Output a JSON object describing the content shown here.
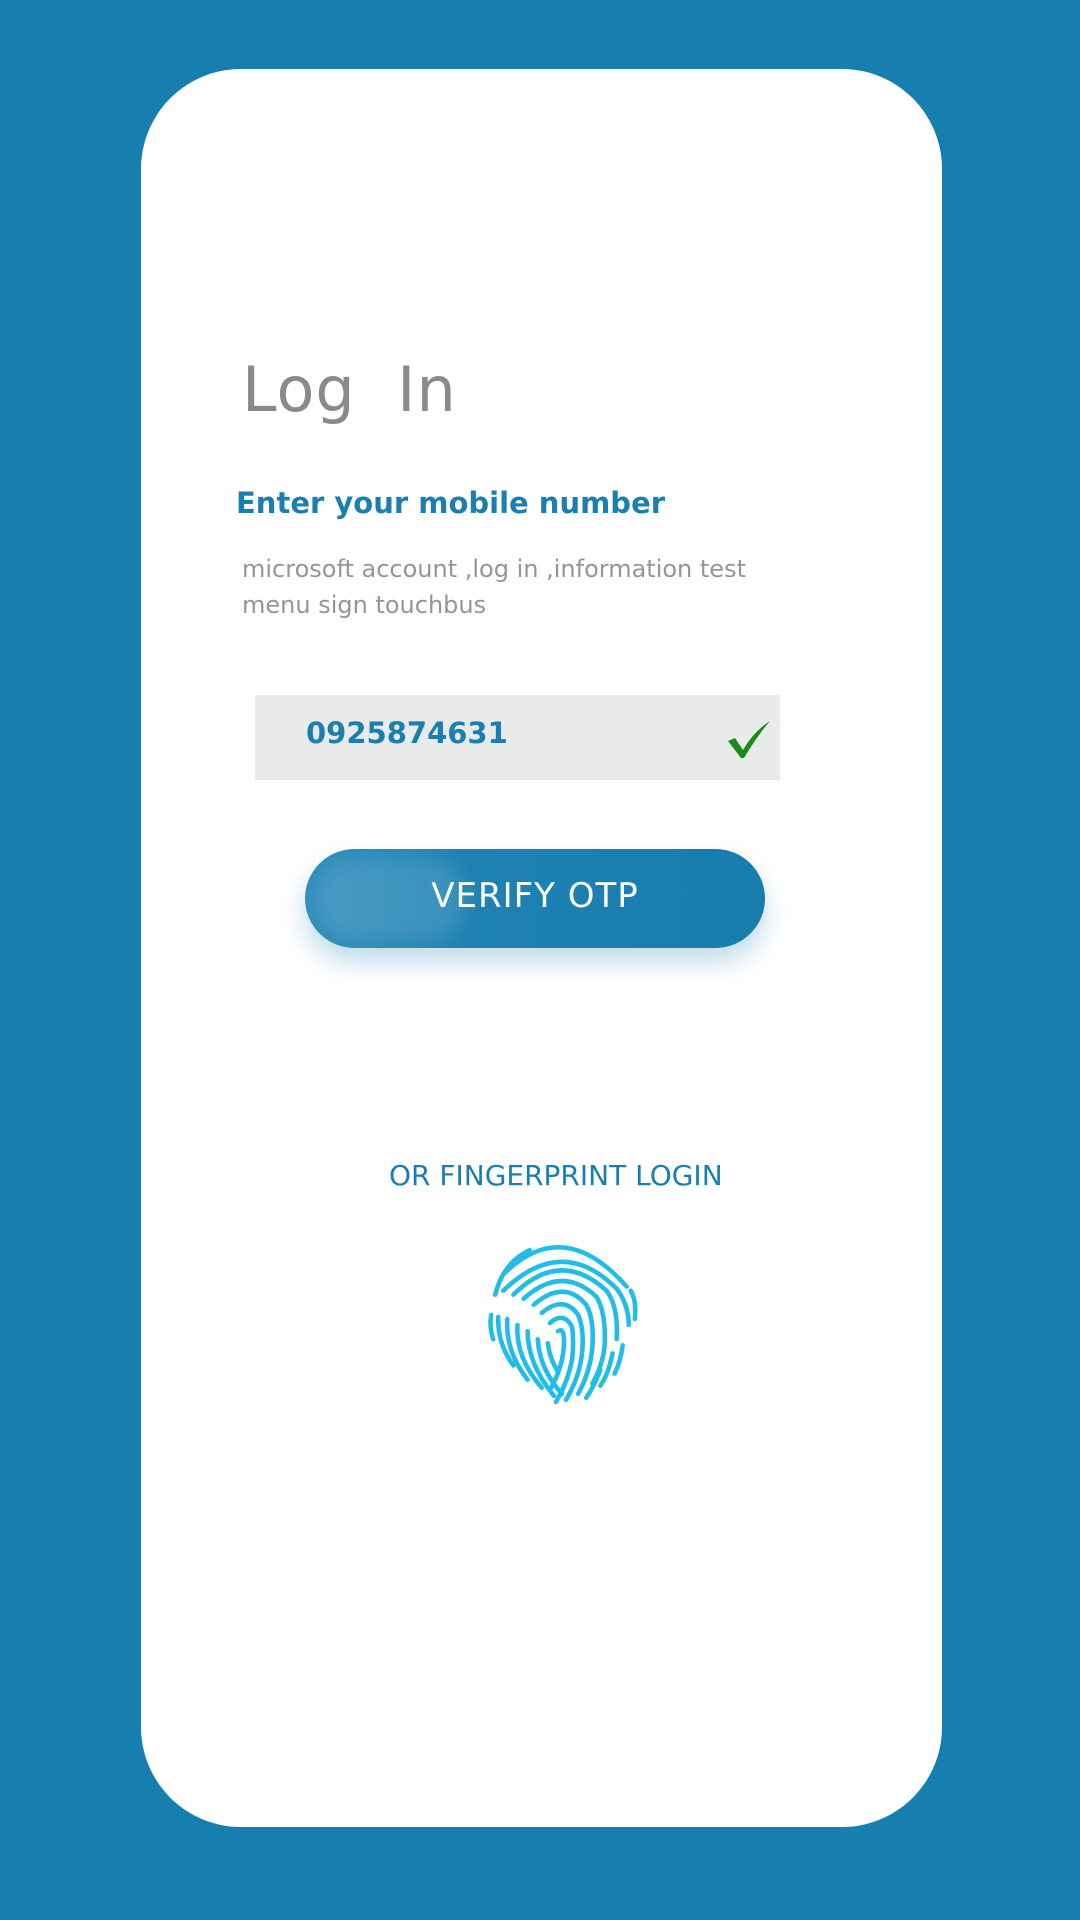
{
  "login": {
    "title": "Log  In",
    "prompt": "Enter your mobile number",
    "description": "microsoft account ,log in ,information test menu sign touchbus",
    "phone_value": "0925874631",
    "phone_valid_icon": "checkmark-icon",
    "verify_label": "VERIFY OTP",
    "fingerprint_label": "OR FINGERPRINT LOGIN",
    "fingerprint_icon": "fingerprint-icon"
  },
  "colors": {
    "background": "#177fb0",
    "card": "#ffffff",
    "accent": "#1a7fb0",
    "field_background": "#e9ebeb",
    "check": "#1b8a1b",
    "fingerprint": "#21bde8"
  }
}
